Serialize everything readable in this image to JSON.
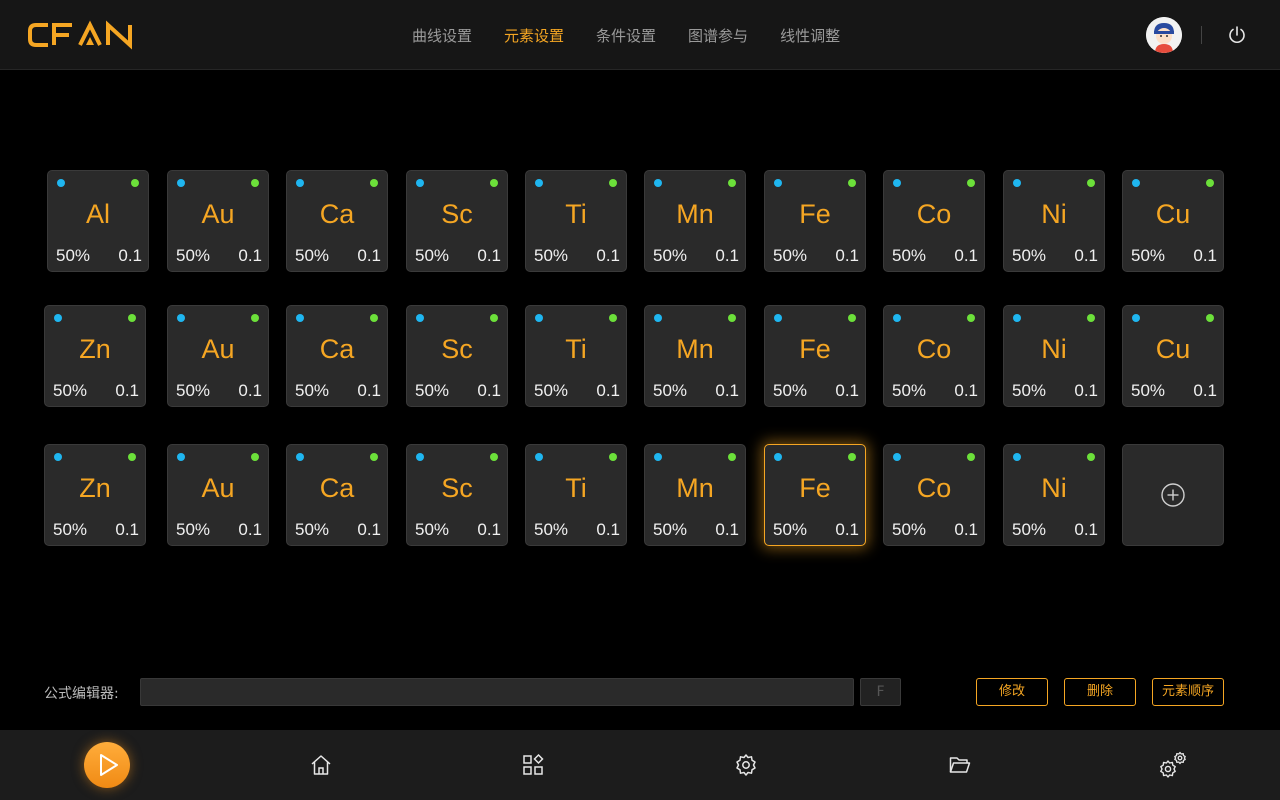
{
  "header": {
    "logo_text": "CFAN",
    "nav": [
      {
        "label": "曲线设置",
        "active": false
      },
      {
        "label": "元素设置",
        "active": true
      },
      {
        "label": "条件设置",
        "active": false
      },
      {
        "label": "图谱参与",
        "active": false
      },
      {
        "label": "线性调整",
        "active": false
      }
    ],
    "icons": {
      "avatar": "user-avatar",
      "power": "power-icon"
    }
  },
  "colors": {
    "accent": "#f5a623",
    "dot_blue": "#1fb6f0",
    "dot_green": "#6ce03a"
  },
  "grid": {
    "rows": [
      [
        {
          "symbol": "Al",
          "percent": "50%",
          "value": "0.1"
        },
        {
          "symbol": "Au",
          "percent": "50%",
          "value": "0.1"
        },
        {
          "symbol": "Ca",
          "percent": "50%",
          "value": "0.1"
        },
        {
          "symbol": "Sc",
          "percent": "50%",
          "value": "0.1"
        },
        {
          "symbol": "Ti",
          "percent": "50%",
          "value": "0.1"
        },
        {
          "symbol": "Mn",
          "percent": "50%",
          "value": "0.1"
        },
        {
          "symbol": "Fe",
          "percent": "50%",
          "value": "0.1"
        },
        {
          "symbol": "Co",
          "percent": "50%",
          "value": "0.1"
        },
        {
          "symbol": "Ni",
          "percent": "50%",
          "value": "0.1"
        },
        {
          "symbol": "Cu",
          "percent": "50%",
          "value": "0.1"
        }
      ],
      [
        {
          "symbol": "Zn",
          "percent": "50%",
          "value": "0.1"
        },
        {
          "symbol": "Au",
          "percent": "50%",
          "value": "0.1"
        },
        {
          "symbol": "Ca",
          "percent": "50%",
          "value": "0.1"
        },
        {
          "symbol": "Sc",
          "percent": "50%",
          "value": "0.1"
        },
        {
          "symbol": "Ti",
          "percent": "50%",
          "value": "0.1"
        },
        {
          "symbol": "Mn",
          "percent": "50%",
          "value": "0.1"
        },
        {
          "symbol": "Fe",
          "percent": "50%",
          "value": "0.1"
        },
        {
          "symbol": "Co",
          "percent": "50%",
          "value": "0.1"
        },
        {
          "symbol": "Ni",
          "percent": "50%",
          "value": "0.1"
        },
        {
          "symbol": "Cu",
          "percent": "50%",
          "value": "0.1"
        }
      ],
      [
        {
          "symbol": "Zn",
          "percent": "50%",
          "value": "0.1"
        },
        {
          "symbol": "Au",
          "percent": "50%",
          "value": "0.1"
        },
        {
          "symbol": "Ca",
          "percent": "50%",
          "value": "0.1"
        },
        {
          "symbol": "Sc",
          "percent": "50%",
          "value": "0.1"
        },
        {
          "symbol": "Ti",
          "percent": "50%",
          "value": "0.1"
        },
        {
          "symbol": "Mn",
          "percent": "50%",
          "value": "0.1"
        },
        {
          "symbol": "Fe",
          "percent": "50%",
          "value": "0.1",
          "selected": true
        },
        {
          "symbol": "Co",
          "percent": "50%",
          "value": "0.1"
        },
        {
          "symbol": "Ni",
          "percent": "50%",
          "value": "0.1"
        }
      ]
    ],
    "add_icon": "plus-circle-icon"
  },
  "formula_editor": {
    "label": "公式编辑器:",
    "value": "",
    "placeholder": "",
    "f_button": "F",
    "buttons": [
      "修改",
      "删除",
      "元素顺序"
    ]
  },
  "footer": {
    "icons": [
      "play-icon",
      "home-icon",
      "apps-icon",
      "settings-icon",
      "folder-icon",
      "advanced-settings-icon"
    ]
  }
}
